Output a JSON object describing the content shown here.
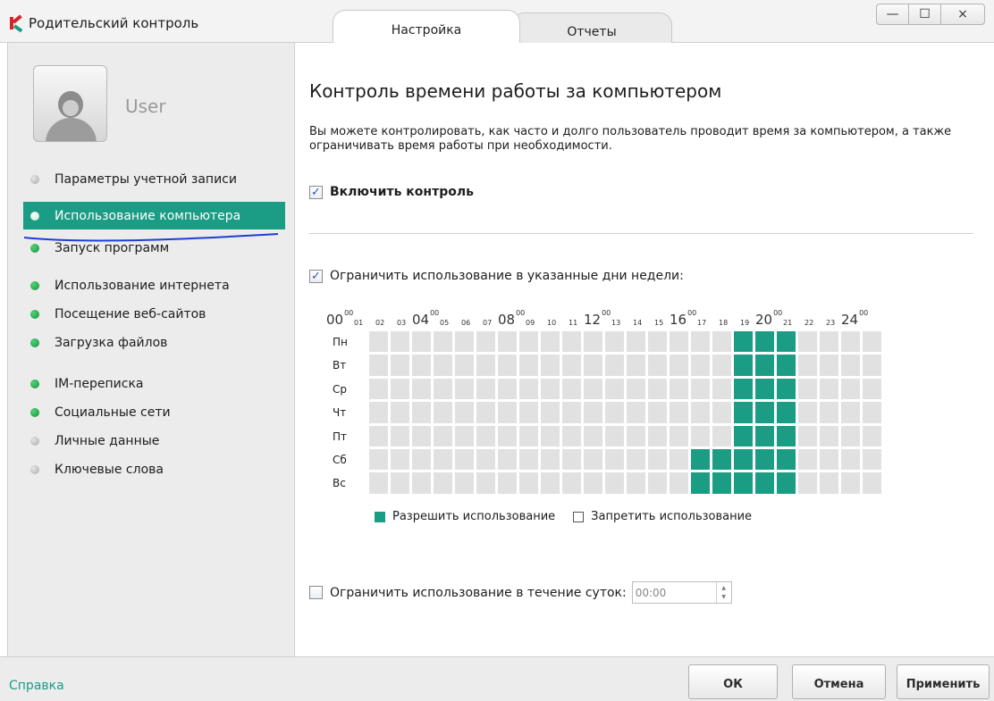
{
  "window": {
    "title": "Родительский контроль",
    "tabs": [
      "Настройка",
      "Отчеты"
    ],
    "controls": {
      "minimize": "—",
      "maximize": "☐",
      "close": "×"
    }
  },
  "sidebar": {
    "username": "User",
    "items": [
      {
        "label": "Параметры учетной записи",
        "status": "grey"
      },
      {
        "label": "Использование компьютера",
        "status": "white",
        "active": true
      },
      {
        "label": "Запуск программ",
        "status": "green"
      },
      {
        "label": "Использование интернета",
        "status": "green"
      },
      {
        "label": "Посещение веб-сайтов",
        "status": "green"
      },
      {
        "label": "Загрузка файлов",
        "status": "green"
      },
      {
        "label": "IM-переписка",
        "status": "green"
      },
      {
        "label": "Социальные сети",
        "status": "green"
      },
      {
        "label": "Личные данные",
        "status": "grey"
      },
      {
        "label": "Ключевые слова",
        "status": "grey"
      }
    ]
  },
  "main": {
    "title": "Контроль времени работы за компьютером",
    "description": "Вы можете контролировать, как часто и долго пользователь проводит время за компьютером, а также ограничивать время работы при необходимости.",
    "enable_control": {
      "label": "Включить контроль",
      "checked": true
    },
    "limit_days": {
      "label": "Ограничить использование в указанные дни недели:",
      "checked": true
    },
    "schedule": {
      "hour_labels": [
        "00",
        "01",
        "02",
        "03",
        "04",
        "05",
        "06",
        "07",
        "08",
        "09",
        "10",
        "11",
        "12",
        "13",
        "14",
        "15",
        "16",
        "17",
        "18",
        "19",
        "20",
        "21",
        "22",
        "23",
        "24"
      ],
      "superscript": "00",
      "days": [
        "Пн",
        "Вт",
        "Ср",
        "Чт",
        "Пт",
        "Сб",
        "Вс"
      ],
      "allowed_hours": {
        "Пн": [
          17,
          18,
          19
        ],
        "Вт": [
          17,
          18,
          19
        ],
        "Ср": [
          17,
          18,
          19
        ],
        "Чт": [
          17,
          18,
          19
        ],
        "Пт": [
          17,
          18,
          19
        ],
        "Сб": [
          15,
          16,
          17,
          18,
          19
        ],
        "Вс": [
          15,
          16,
          17,
          18,
          19
        ]
      },
      "legend_allow": "Разрешить использование",
      "legend_deny": "Запретить использование",
      "allow_color": "#1b9c85",
      "deny_color": "#e1e1e1"
    },
    "limit_daily": {
      "label": "Ограничить использование в течение суток:",
      "checked": false,
      "value": "00:00"
    }
  },
  "footer": {
    "help": "Справка",
    "ok": "ОК",
    "cancel": "Отмена",
    "apply": "Применить"
  }
}
